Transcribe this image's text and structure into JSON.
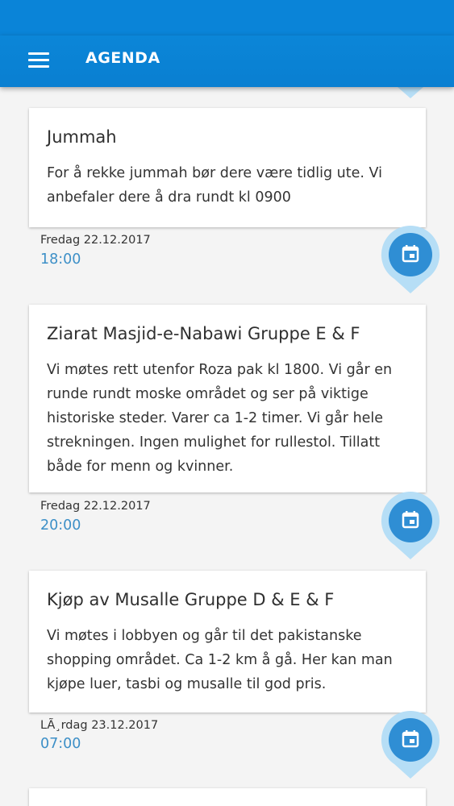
{
  "app": {
    "title": "AGENDA"
  },
  "events": [
    {
      "title": "Jummah",
      "description": "For å rekke jummah bør dere være tidlig ute. Vi anbefaler dere å dra rundt kl 0900",
      "date": "Fredag 22.12.2017",
      "time": "18:00"
    },
    {
      "title": "Ziarat Masjid-e-Nabawi Gruppe E & F",
      "description": "Vi møtes rett utenfor Roza pak kl 1800. Vi går en runde rundt moske området og ser på viktige historiske steder. Varer ca 1-2 timer. Vi går hele strekningen. Ingen mulighet for rullestol. Tillatt både for menn og kvinner.",
      "date": "Fredag 22.12.2017",
      "time": "20:00"
    },
    {
      "title": "Kjøp av Musalle Gruppe D & E & F",
      "description": "Vi møtes i lobbyen og går til det pakistanske shopping området. Ca 1-2 km å gå. Her kan man kjøpe luer, tasbi og musalle til god pris.",
      "date": "LÃ¸rdag 23.12.2017",
      "time": "07:00"
    }
  ],
  "colors": {
    "appbar": "#0a84d8",
    "accent": "#3c8fc7",
    "fab_outer": "#b6def6",
    "fab_inner": "#2f8ed4"
  },
  "icons": {
    "menu": "hamburger-menu-icon",
    "calendar": "calendar-icon"
  }
}
